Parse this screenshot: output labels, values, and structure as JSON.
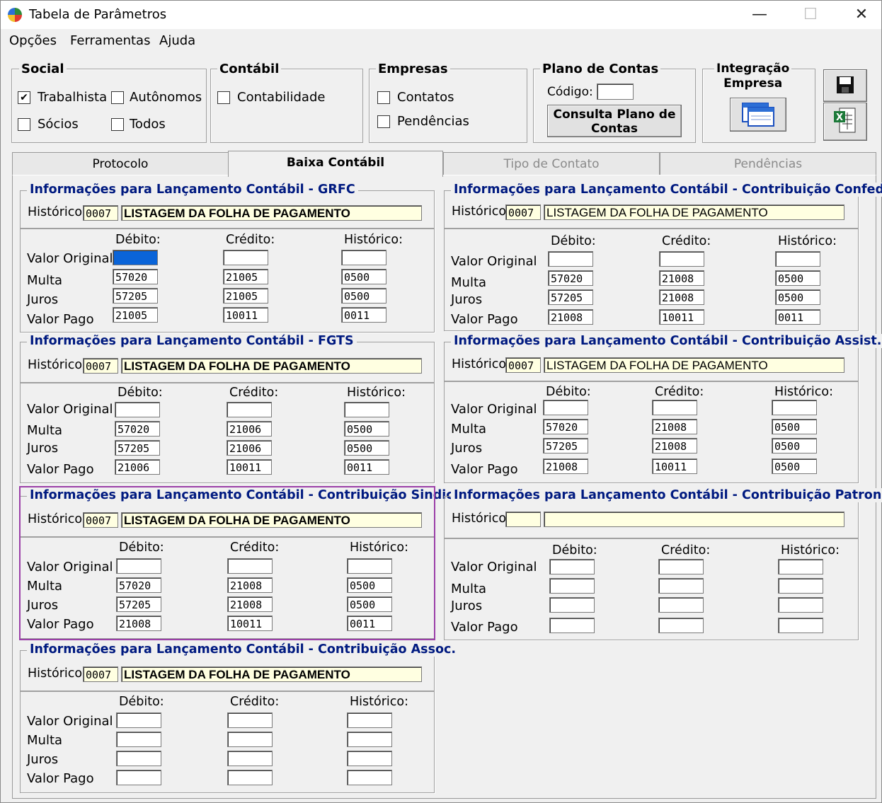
{
  "window": {
    "title": "Tabela de Parâmetros",
    "min": "—",
    "max": "☐",
    "close": "✕"
  },
  "menu": [
    "Opções",
    "Ferramentas",
    "Ajuda"
  ],
  "social": {
    "title": "Social",
    "trabalhista": "Trabalhista",
    "autonomos": "Autônomos",
    "socios": "Sócios",
    "todos": "Todos"
  },
  "contabil": {
    "title": "Contábil",
    "contabilidade": "Contabilidade"
  },
  "empresas": {
    "title": "Empresas",
    "contatos": "Contatos",
    "pendencias": "Pendências"
  },
  "plano": {
    "title": "Plano de Contas",
    "codigo_label": "Código:",
    "codigo_value": "",
    "consulta_line1": "Consulta Plano de",
    "consulta_line2": "Contas"
  },
  "integracao": {
    "title_line1": "Integração",
    "title_line2": "Empresa"
  },
  "tabs": [
    "Protocolo",
    "Baixa Contábil",
    "Tipo de Contato",
    "Pendências"
  ],
  "labels": {
    "historico": "Histórico:",
    "debito": "Débito:",
    "credito": "Crédito:",
    "valor_original": "Valor Original",
    "multa": "Multa",
    "juros": "Juros",
    "valor_pago": "Valor Pago"
  },
  "sections": {
    "grfc": {
      "title": "Informações para Lançamento Contábil - GRFC",
      "hist_code": "0007",
      "hist_text": "LISTAGEM DA FOLHA DE PAGAMENTO",
      "rows": [
        [
          "",
          "",
          ""
        ],
        [
          "57020",
          "21005",
          "0500"
        ],
        [
          "57205",
          "21005",
          "0500"
        ],
        [
          "21005",
          "10011",
          "0011"
        ]
      ]
    },
    "fgts": {
      "title": "Informações para Lançamento Contábil - FGTS",
      "hist_code": "0007",
      "hist_text": "LISTAGEM DA FOLHA DE PAGAMENTO",
      "rows": [
        [
          "",
          "",
          ""
        ],
        [
          "57020",
          "21006",
          "0500"
        ],
        [
          "57205",
          "21006",
          "0500"
        ],
        [
          "21006",
          "10011",
          "0011"
        ]
      ]
    },
    "sindical": {
      "title": "Informações para Lançamento Contábil - Contribuição Sindical",
      "hist_code": "0007",
      "hist_text": "LISTAGEM DA FOLHA DE PAGAMENTO",
      "rows": [
        [
          "",
          "",
          ""
        ],
        [
          "57020",
          "21008",
          "0500"
        ],
        [
          "57205",
          "21008",
          "0500"
        ],
        [
          "21008",
          "10011",
          "0011"
        ]
      ]
    },
    "assoc": {
      "title": "Informações para Lançamento Contábil - Contribuição Assoc.",
      "hist_code": "0007",
      "hist_text": "LISTAGEM DA FOLHA DE PAGAMENTO",
      "rows": [
        [
          "",
          "",
          ""
        ],
        [
          "",
          "",
          ""
        ],
        [
          "",
          "",
          ""
        ],
        [
          "",
          "",
          ""
        ]
      ]
    },
    "confed": {
      "title": "Informações para Lançamento Contábil - Contribuição Confed.",
      "hist_code": "0007",
      "hist_text": "LISTAGEM DA FOLHA DE PAGAMENTO",
      "rows": [
        [
          "",
          "",
          ""
        ],
        [
          "57020",
          "21008",
          "0500"
        ],
        [
          "57205",
          "21008",
          "0500"
        ],
        [
          "21008",
          "10011",
          "0011"
        ]
      ]
    },
    "assist": {
      "title": "Informações para Lançamento Contábil - Contribuição Assist.",
      "hist_code": "0007",
      "hist_text": "LISTAGEM DA FOLHA DE PAGAMENTO",
      "rows": [
        [
          "",
          "",
          ""
        ],
        [
          "57020",
          "21008",
          "0500"
        ],
        [
          "57205",
          "21008",
          "0500"
        ],
        [
          "21008",
          "10011",
          "0500"
        ]
      ]
    },
    "patronal": {
      "title": "Informações para Lançamento Contábil - Contribuição Patronal.",
      "hist_code": "",
      "hist_text": "",
      "rows": [
        [
          "",
          "",
          ""
        ],
        [
          "",
          "",
          ""
        ],
        [
          "",
          "",
          ""
        ],
        [
          "",
          "",
          ""
        ]
      ]
    }
  }
}
